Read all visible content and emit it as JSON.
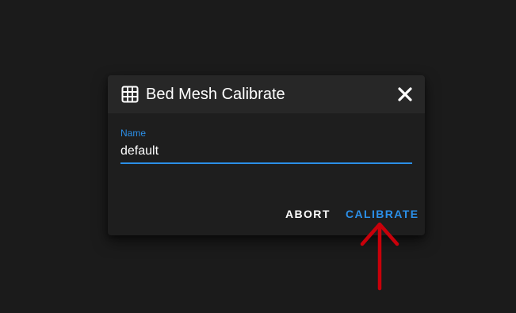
{
  "dialog": {
    "title": "Bed Mesh Calibrate",
    "title_icon": "grid-icon",
    "close_icon": "close-icon"
  },
  "form": {
    "name_label": "Name",
    "name_value": "default"
  },
  "actions": {
    "abort_label": "ABORT",
    "calibrate_label": "CALIBRATE"
  },
  "annotation": {
    "arrow_icon": "arrow-up-icon",
    "arrow_color": "#c8000a"
  },
  "colors": {
    "accent": "#2b8fe8",
    "background": "#1b1b1b",
    "dialog": "#1e1e1e",
    "dialog_header": "#272727"
  }
}
